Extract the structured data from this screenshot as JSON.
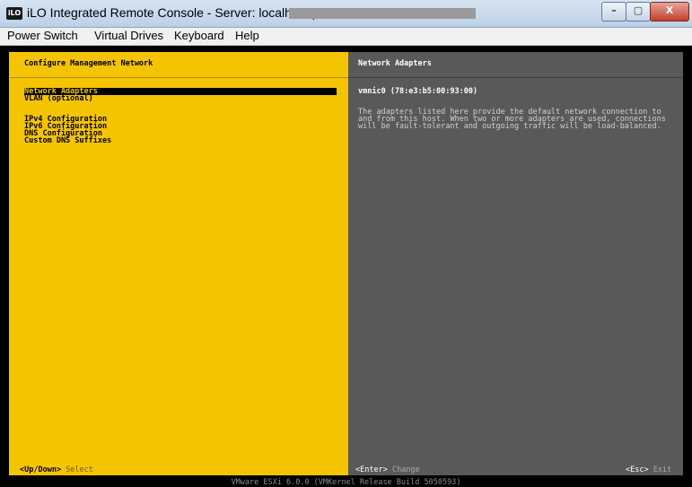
{
  "window": {
    "logo": "iLO",
    "title": "iLO Integrated Remote Console - Server: localhost |",
    "controls": {
      "minimize": "–",
      "maximize": "▢",
      "close": "X"
    }
  },
  "menubar": {
    "items": [
      "Power Switch",
      "Virtual Drives",
      "Keyboard",
      "Help"
    ]
  },
  "left_panel": {
    "title": "Configure Management Network",
    "items": [
      {
        "label": "Network Adapters",
        "selected": true
      },
      {
        "label": "VLAN (optional)",
        "selected": false
      },
      {
        "label": "IPv4 Configuration",
        "selected": false
      },
      {
        "label": "IPv6 Configuration",
        "selected": false
      },
      {
        "label": "DNS Configuration",
        "selected": false
      },
      {
        "label": "Custom DNS Suffixes",
        "selected": false
      }
    ],
    "footer_key": "<Up/Down>",
    "footer_action": "Select"
  },
  "right_panel": {
    "title": "Network Adapters",
    "nic": "vmnic0 (78:e3:b5:00:93:00)",
    "description": "The adapters listed here provide the default network connection to and from this host. When two or more adapters are used, connections will be fault-tolerant and outgoing traffic will be load-balanced.",
    "footer_enter_key": "<Enter>",
    "footer_enter_action": "Change",
    "footer_esc_key": "<Esc>",
    "footer_esc_action": "Exit"
  },
  "status_bar": "VMware ESXi 6.0.0 (VMKernel Release Build 5050593)",
  "colors": {
    "yellow_panel": "#f5c400",
    "gray_panel": "#595959",
    "console_bg": "#000000"
  }
}
